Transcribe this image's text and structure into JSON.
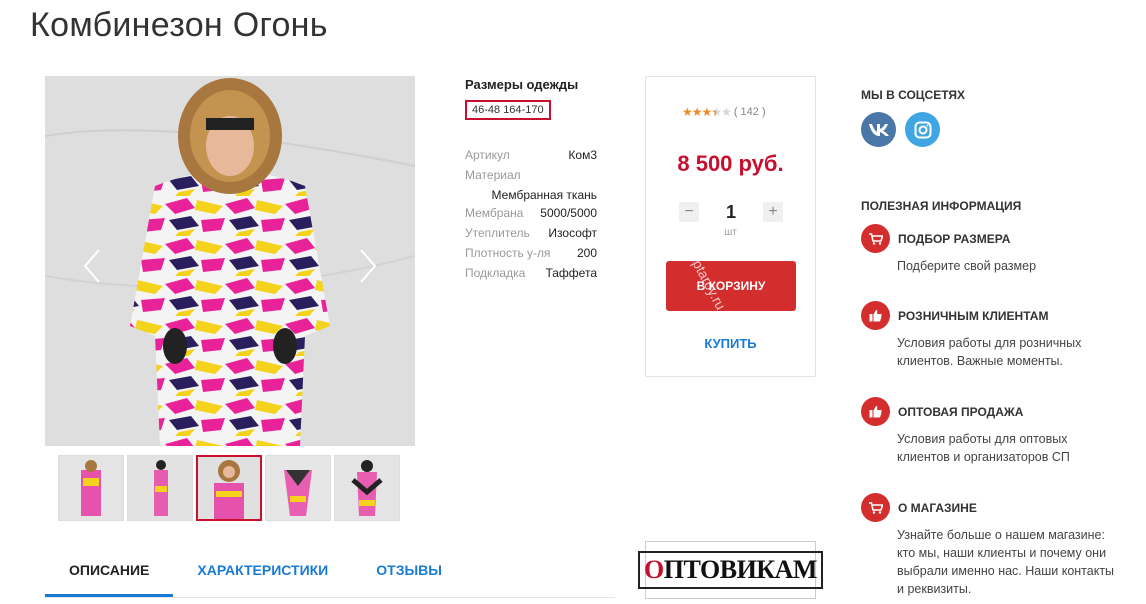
{
  "product": {
    "title": "Комбинезон Огонь",
    "sizes_title": "Размеры одежды",
    "selected_size": "46-48 164-170",
    "properties": [
      {
        "key": "Артикул",
        "value": "Ком3"
      },
      {
        "key": "Материал",
        "value": "Мембранная ткань"
      },
      {
        "key": "Мембрана",
        "value": "5000/5000"
      },
      {
        "key": "Утеплитель",
        "value": "Изософт"
      },
      {
        "key": "Плотность у-ля",
        "value": "200"
      },
      {
        "key": "Подкладка",
        "value": "Таффета"
      }
    ]
  },
  "gallery": {
    "thumb_count": 5,
    "active_thumb": 3
  },
  "tabs": [
    {
      "label": "ОПИСАНИЕ",
      "active": true
    },
    {
      "label": "ХАРАКТЕРИСТИКИ",
      "active": false
    },
    {
      "label": "ОТЗЫВЫ",
      "active": false
    }
  ],
  "buy_box": {
    "rating_value": 3.5,
    "rating_max": 5,
    "review_count": "( 142 )",
    "price": "8 500 руб.",
    "quantity": "1",
    "minus": "−",
    "plus": "+",
    "unit": "шт",
    "cart_button": "В КОРЗИНУ",
    "buy_link": "КУПИТЬ",
    "watermark": "optaroy.ru"
  },
  "banner": {
    "first_letter": "О",
    "rest": "ПТОВИКАМ"
  },
  "sidebar": {
    "social_title": "МЫ В СОЦСЕТЯХ",
    "info_title": "ПОЛЕЗНАЯ ИНФОРМАЦИЯ",
    "items": [
      {
        "title": "ПОДБОР РАЗМЕРА",
        "desc": "Подберите свой размер",
        "icon": "cart-icon"
      },
      {
        "title": "РОЗНИЧНЫМ КЛИЕНТАМ",
        "desc": "Условия работы для розничных клиентов. Важные моменты.",
        "icon": "thumbs-up-icon"
      },
      {
        "title": "ОПТОВАЯ ПРОДАЖА",
        "desc": "Условия работы для оптовых клиентов и организаторов СП",
        "icon": "thumbs-up-icon"
      },
      {
        "title": "О МАГАЗИНЕ",
        "desc": "Узнайте больше о нашем магазине: кто мы, наши клиенты и почему они выбрали именно нас. Наши контакты и реквизиты.",
        "icon": "cart-icon"
      }
    ]
  },
  "colors": {
    "accent_red": "#d42d2d",
    "price_red": "#c8102e",
    "link_blue": "#1a7bd6",
    "star_orange": "#f08a24"
  }
}
